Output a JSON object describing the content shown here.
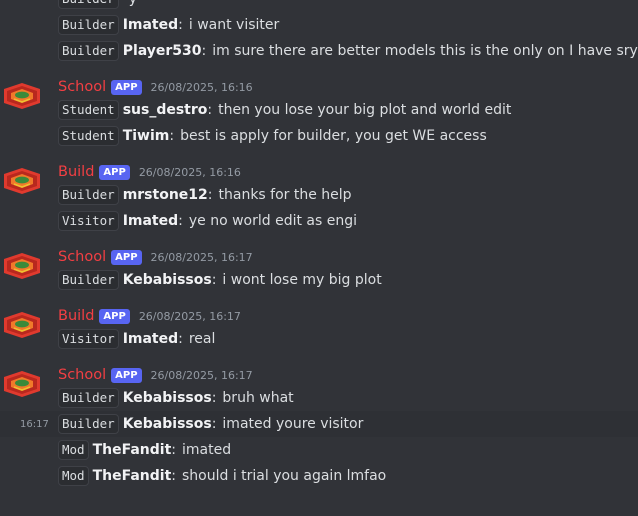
{
  "colors": {
    "background": "#313338",
    "accent_red": "#f23f43",
    "app_badge": "#5865f2"
  },
  "groups": [
    {
      "author": "",
      "badge": "",
      "timestamp": "",
      "lines": [
        {
          "role": "Builder",
          "user": "",
          "text": "y"
        },
        {
          "role": "Builder",
          "user": "Imated",
          "text": "i want visiter"
        },
        {
          "role": "Builder",
          "user": "Player530",
          "text": "im sure there are better models this is the only on I have sry"
        }
      ]
    },
    {
      "author": "School",
      "badge": "APP",
      "timestamp": "26/08/2025, 16:16",
      "lines": [
        {
          "role": "Student",
          "user": "sus_destro",
          "text": "then you lose your big plot and world edit"
        },
        {
          "role": "Student",
          "user": "Tiwim",
          "text": "best is apply for builder, you get WE access"
        }
      ]
    },
    {
      "author": "Build",
      "badge": "APP",
      "timestamp": "26/08/2025, 16:16",
      "lines": [
        {
          "role": "Builder",
          "user": "mrstone12",
          "text": "thanks for the help"
        },
        {
          "role": "Visitor",
          "user": "Imated",
          "text": "ye no world edit as engi"
        }
      ]
    },
    {
      "author": "School",
      "badge": "APP",
      "timestamp": "26/08/2025, 16:17",
      "lines": [
        {
          "role": "Builder",
          "user": "Kebabissos",
          "text": "i wont lose my big plot"
        }
      ]
    },
    {
      "author": "Build",
      "badge": "APP",
      "timestamp": "26/08/2025, 16:17",
      "lines": [
        {
          "role": "Visitor",
          "user": "Imated",
          "text": "real"
        }
      ]
    },
    {
      "author": "School",
      "badge": "APP",
      "timestamp": "26/08/2025, 16:17",
      "lines": [
        {
          "role": "Builder",
          "user": "Kebabissos",
          "text": "bruh what"
        },
        {
          "role": "Builder",
          "user": "Kebabissos",
          "text": "imated youre visitor",
          "hover_time": "16:17"
        },
        {
          "role": "Mod",
          "user": "TheFandit",
          "text": "imated"
        },
        {
          "role": "Mod",
          "user": "TheFandit",
          "text": "should i trial you again lmfao"
        }
      ]
    }
  ]
}
